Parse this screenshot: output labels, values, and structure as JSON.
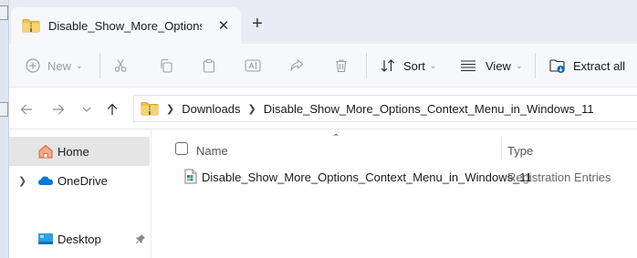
{
  "window": {
    "tab_title": "Disable_Show_More_Options_",
    "close_glyph": "✕",
    "new_tab_glyph": "+"
  },
  "command_bar": {
    "new_label": "New",
    "sort_label": "Sort",
    "view_label": "View",
    "extract_label": "Extract all"
  },
  "address": {
    "crumbs": [
      "Downloads",
      "Disable_Show_More_Options_Context_Menu_in_Windows_11"
    ]
  },
  "sidebar": {
    "items": [
      {
        "label": "Home",
        "icon": "home-icon",
        "selected": true
      },
      {
        "label": "OneDrive",
        "icon": "cloud-icon",
        "expandable": true
      },
      {
        "label": "Desktop",
        "icon": "desktop-icon",
        "pinned": true
      }
    ]
  },
  "content": {
    "columns": {
      "name": "Name",
      "type": "Type"
    },
    "files": [
      {
        "name": "Disable_Show_More_Options_Context_Menu_in_Windows_11",
        "type": "Registration Entries",
        "icon": "registry-file-icon"
      }
    ]
  },
  "colors": {
    "accent": "#0067c0",
    "folder_yellow": "#f2c14e",
    "onedrive_blue": "#0078d4"
  }
}
